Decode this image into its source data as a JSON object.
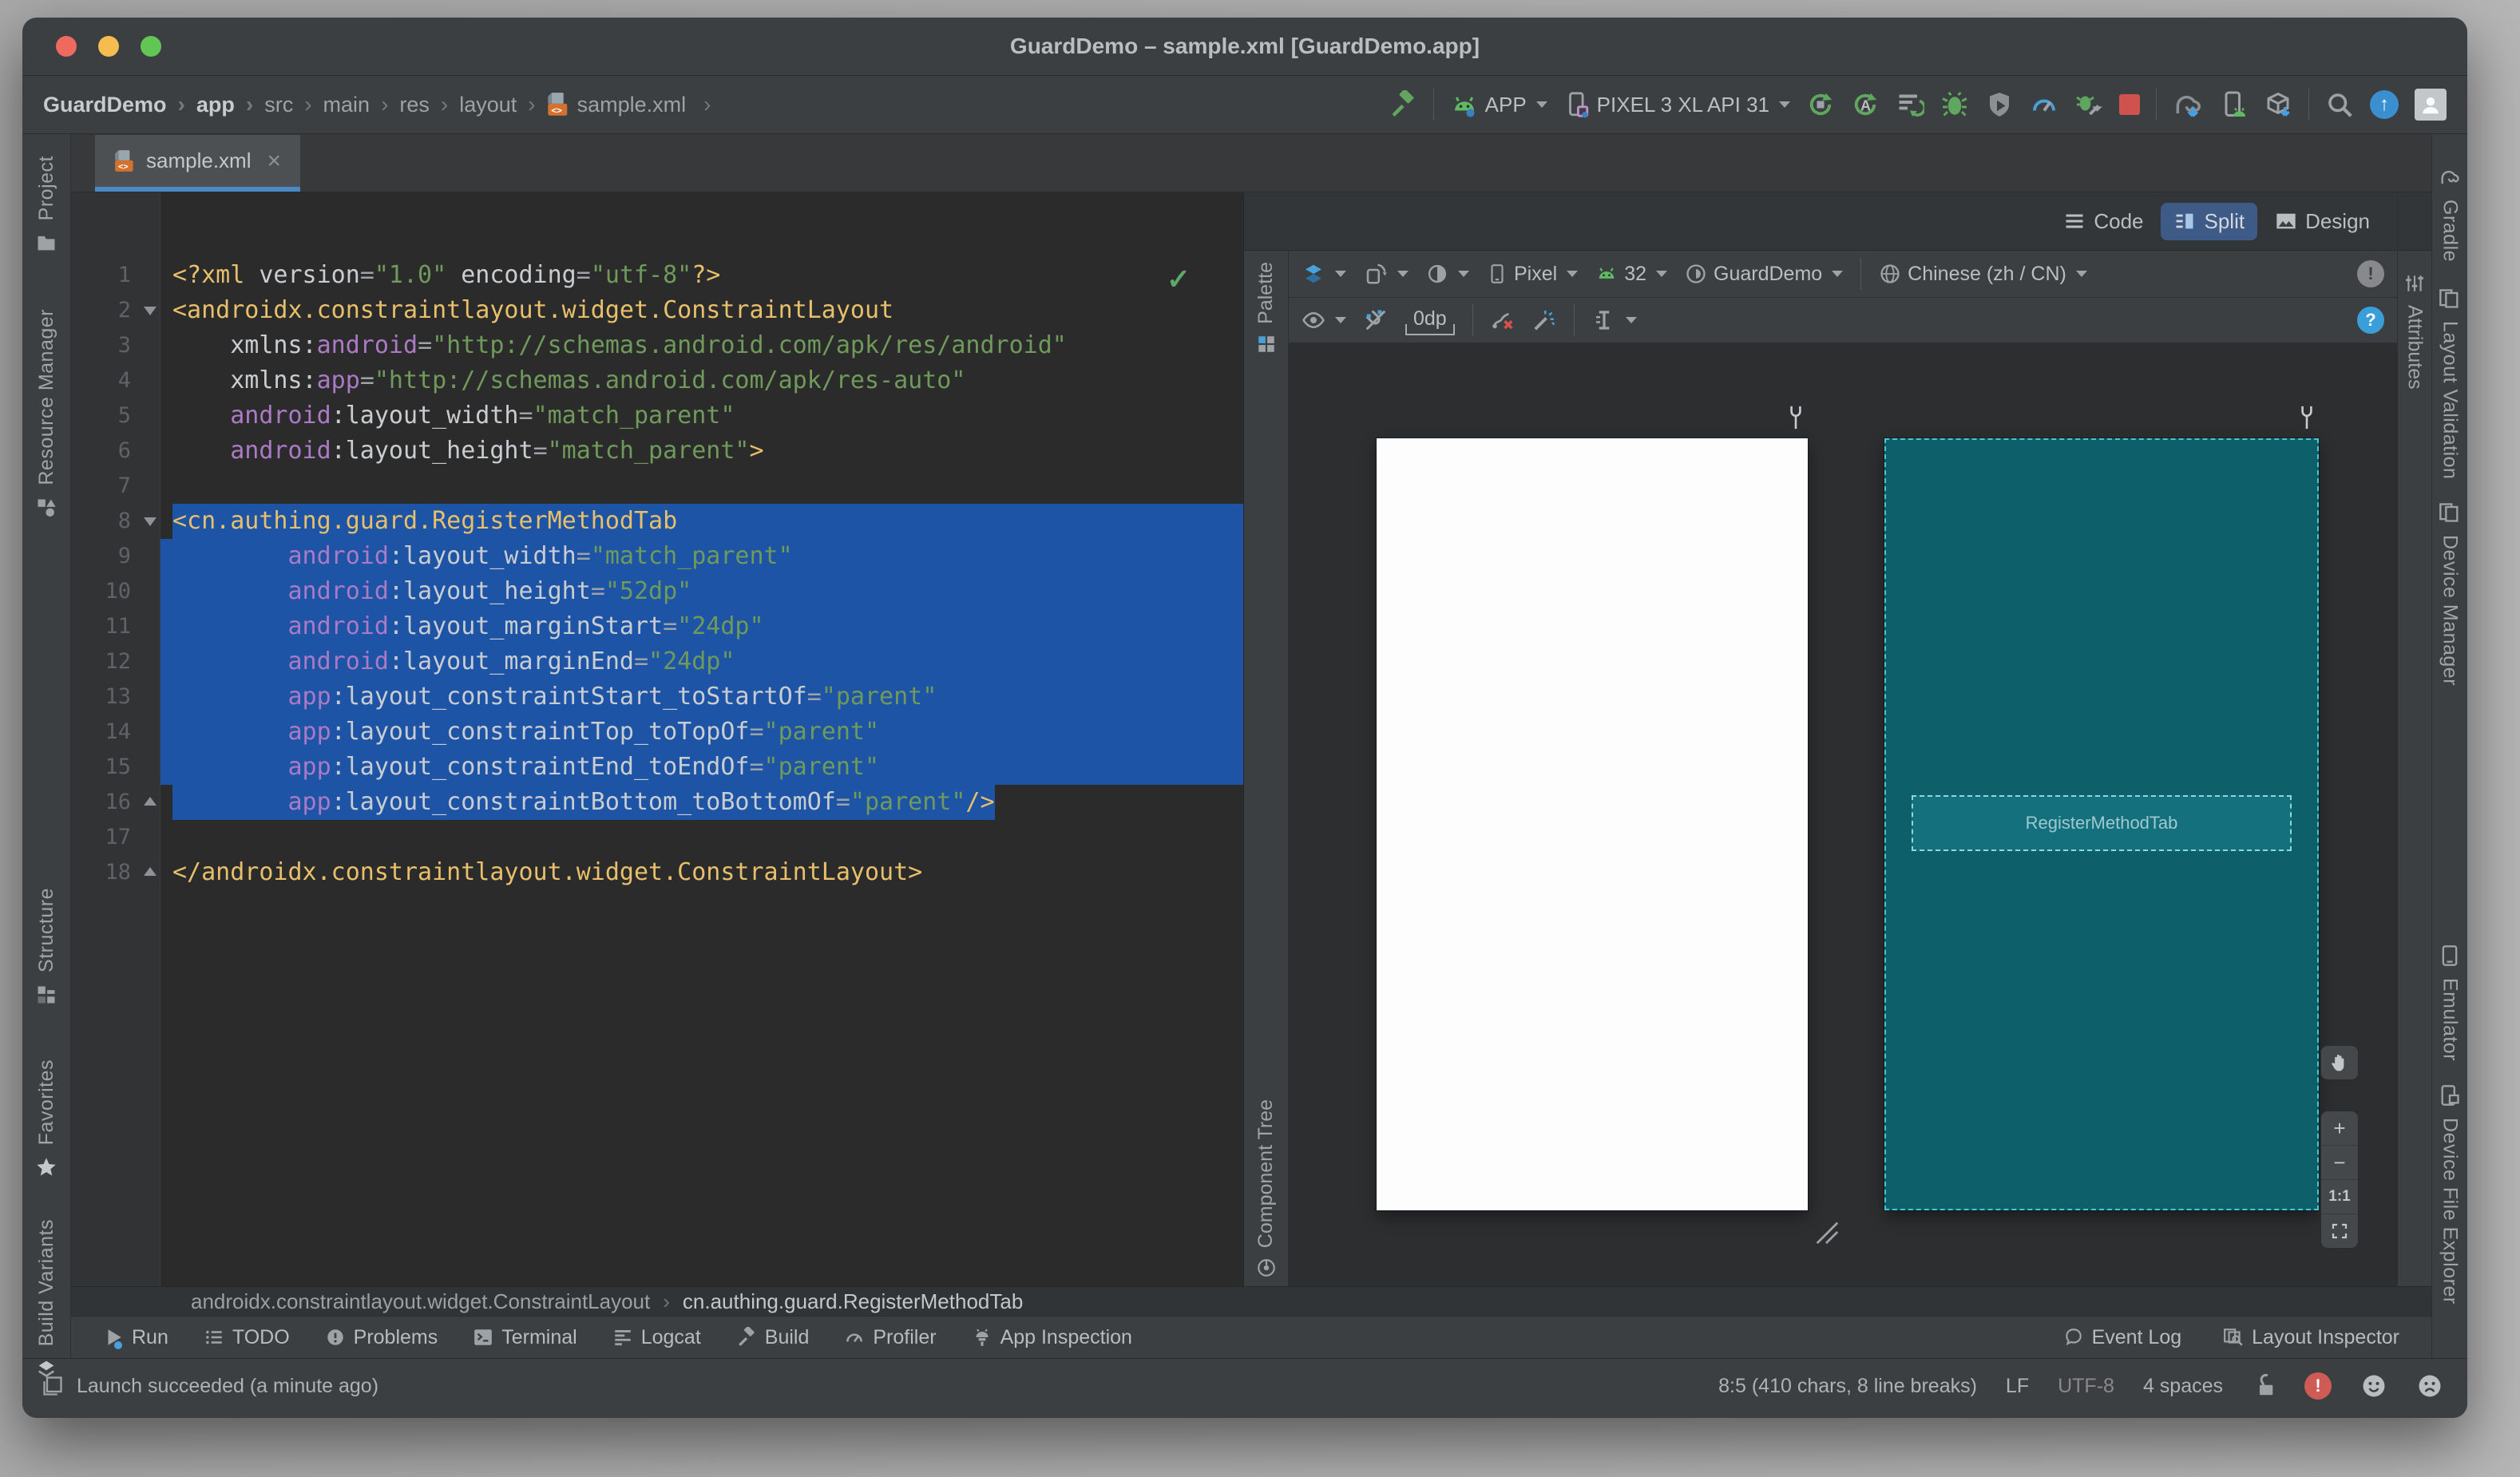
{
  "window": {
    "title": "GuardDemo – sample.xml [GuardDemo.app]"
  },
  "toolbar": {
    "breadcrumbs": [
      "GuardDemo",
      "app",
      "src",
      "main",
      "res",
      "layout",
      "sample.xml"
    ],
    "run_config": "APP",
    "device": "PIXEL 3 XL API 31"
  },
  "tabs": {
    "active": "sample.xml"
  },
  "left_stripe": [
    "Project",
    "Resource Manager",
    "Structure",
    "Favorites",
    "Build Variants"
  ],
  "right_stripe": [
    "Gradle",
    "Layout Validation",
    "Device Manager",
    "Emulator",
    "Device File Explorer"
  ],
  "attributes_tab": "Attributes",
  "editor": {
    "lines": [
      {
        "n": 1,
        "i": 0,
        "t": [
          [
            "t",
            "<?xml"
          ],
          [
            "a",
            " version"
          ],
          [
            "e",
            "="
          ],
          [
            "v",
            "\"1.0\""
          ],
          [
            "a",
            " encoding"
          ],
          [
            "e",
            "="
          ],
          [
            "v",
            "\"utf-8\""
          ],
          [
            "t",
            "?>"
          ]
        ]
      },
      {
        "n": 2,
        "i": 0,
        "f": "d",
        "t": [
          [
            "t",
            "<androidx.constraintlayout.widget.ConstraintLayout"
          ]
        ]
      },
      {
        "n": 3,
        "i": 4,
        "t": [
          [
            "a",
            "xmlns:"
          ],
          [
            "n",
            "android"
          ],
          [
            "e",
            "="
          ],
          [
            "v",
            "\"http://schemas.android.com/apk/res/android\""
          ]
        ]
      },
      {
        "n": 4,
        "i": 4,
        "t": [
          [
            "a",
            "xmlns:"
          ],
          [
            "n",
            "app"
          ],
          [
            "e",
            "="
          ],
          [
            "v",
            "\"http://schemas.android.com/apk/res-auto\""
          ]
        ]
      },
      {
        "n": 5,
        "i": 4,
        "t": [
          [
            "n",
            "android"
          ],
          [
            "a",
            ":layout_width"
          ],
          [
            "e",
            "="
          ],
          [
            "v",
            "\"match_parent\""
          ]
        ]
      },
      {
        "n": 6,
        "i": 4,
        "t": [
          [
            "n",
            "android"
          ],
          [
            "a",
            ":layout_height"
          ],
          [
            "e",
            "="
          ],
          [
            "v",
            "\"match_parent\""
          ],
          [
            "t",
            ">"
          ]
        ]
      },
      {
        "n": 7,
        "i": 0,
        "t": []
      },
      {
        "n": 8,
        "i": 0,
        "f": "d",
        "sel": "from",
        "bulb": true,
        "t": [
          [
            "t",
            "<cn.authing.guard.RegisterMethodTab"
          ]
        ]
      },
      {
        "n": 9,
        "i": 8,
        "sel": "full",
        "t": [
          [
            "n",
            "android"
          ],
          [
            "a",
            ":layout_width"
          ],
          [
            "e",
            "="
          ],
          [
            "v",
            "\"match_parent\""
          ]
        ]
      },
      {
        "n": 10,
        "i": 8,
        "sel": "full",
        "t": [
          [
            "n",
            "android"
          ],
          [
            "a",
            ":layout_height"
          ],
          [
            "e",
            "="
          ],
          [
            "v",
            "\"52dp\""
          ]
        ]
      },
      {
        "n": 11,
        "i": 8,
        "sel": "full",
        "t": [
          [
            "n",
            "android"
          ],
          [
            "a",
            ":layout_marginStart"
          ],
          [
            "e",
            "="
          ],
          [
            "v",
            "\"24dp\""
          ]
        ]
      },
      {
        "n": 12,
        "i": 8,
        "sel": "full",
        "t": [
          [
            "n",
            "android"
          ],
          [
            "a",
            ":layout_marginEnd"
          ],
          [
            "e",
            "="
          ],
          [
            "v",
            "\"24dp\""
          ]
        ]
      },
      {
        "n": 13,
        "i": 8,
        "sel": "full",
        "t": [
          [
            "n",
            "app"
          ],
          [
            "a",
            ":layout_constraintStart_toStartOf"
          ],
          [
            "e",
            "="
          ],
          [
            "v",
            "\"parent\""
          ]
        ]
      },
      {
        "n": 14,
        "i": 8,
        "sel": "full",
        "t": [
          [
            "n",
            "app"
          ],
          [
            "a",
            ":layout_constraintTop_toTopOf"
          ],
          [
            "e",
            "="
          ],
          [
            "v",
            "\"parent\""
          ]
        ]
      },
      {
        "n": 15,
        "i": 8,
        "sel": "full",
        "t": [
          [
            "n",
            "app"
          ],
          [
            "a",
            ":layout_constraintEnd_toEndOf"
          ],
          [
            "e",
            "="
          ],
          [
            "v",
            "\"parent\""
          ]
        ]
      },
      {
        "n": 16,
        "i": 8,
        "f": "u",
        "sel": "to",
        "t": [
          [
            "n",
            "app"
          ],
          [
            "a",
            ":layout_constraintBottom_toBottomOf"
          ],
          [
            "e",
            "="
          ],
          [
            "v",
            "\"parent\""
          ],
          [
            "t",
            "/>"
          ]
        ]
      },
      {
        "n": 17,
        "i": 0,
        "t": []
      },
      {
        "n": 18,
        "i": 0,
        "f": "u",
        "t": [
          [
            "t",
            "</androidx.constraintlayout.widget.ConstraintLayout>"
          ]
        ]
      }
    ]
  },
  "design": {
    "palette": "Palette",
    "component_tree": "Component Tree",
    "modes": [
      "Code",
      "Split",
      "Design"
    ],
    "active_mode": "Split",
    "toolbar": {
      "device": "Pixel",
      "api": "32",
      "theme": "GuardDemo",
      "locale": "Chinese (zh / CN)",
      "default_margin": "0dp"
    },
    "badges": {
      "render_error": "!",
      "help": "?"
    },
    "widget_label": "RegisterMethodTab",
    "zoom": {
      "in": "+",
      "out": "−",
      "actual": "1:1"
    }
  },
  "xml_breadcrumbs": [
    "androidx.constraintlayout.widget.ConstraintLayout",
    "cn.authing.guard.RegisterMethodTab"
  ],
  "bottom_bar": {
    "left": [
      "Run",
      "TODO",
      "Problems",
      "Terminal",
      "Logcat",
      "Build",
      "Profiler",
      "App Inspection"
    ],
    "right": [
      "Event Log",
      "Layout Inspector"
    ]
  },
  "status_bar": {
    "message": "Launch succeeded (a minute ago)",
    "position": "8:5 (410 chars, 8 line breaks)",
    "line_sep": "LF",
    "encoding": "UTF-8",
    "indent": "4 spaces",
    "error_badge": "!"
  },
  "colors": {
    "accent_blue": "#4a88c7",
    "selection": "#1d54a5",
    "blueprint_bg": "#0d5f69",
    "tag": "#e8bf6a",
    "value": "#6f9a5b",
    "namespace": "#ab7ac5"
  }
}
